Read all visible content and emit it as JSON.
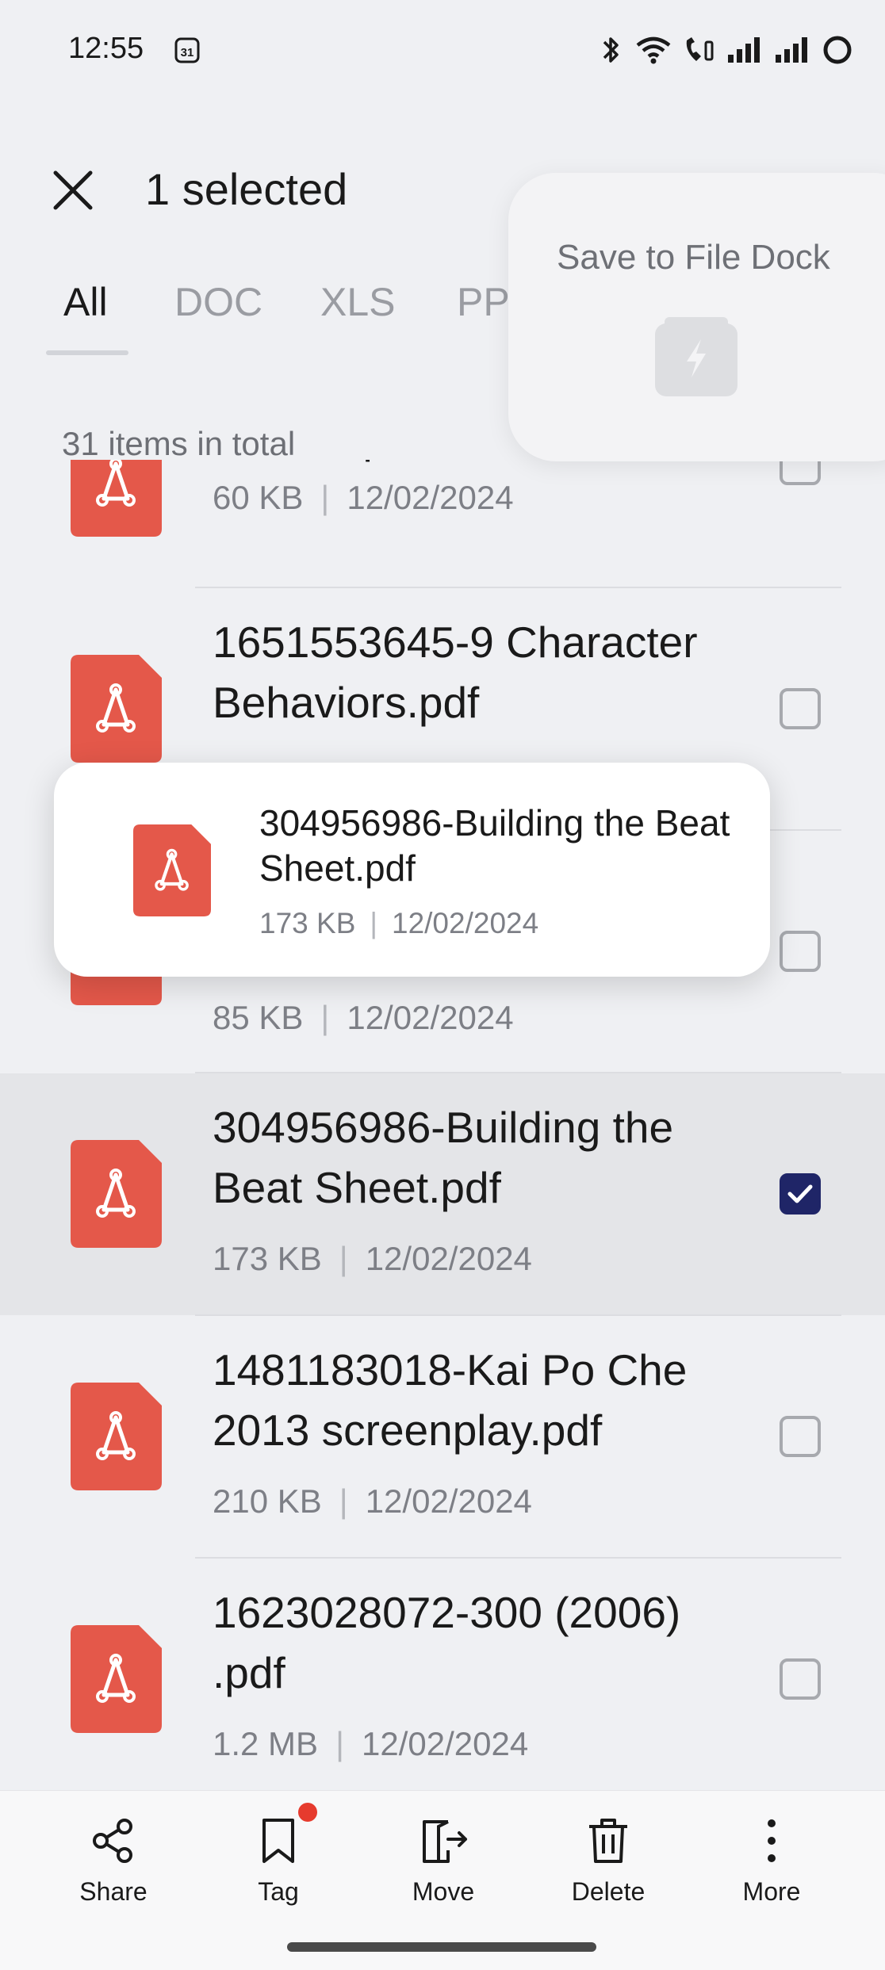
{
  "status_bar": {
    "time": "12:55",
    "calendar_day": "31"
  },
  "header": {
    "title": "1 selected"
  },
  "tabs": [
    {
      "label": "All",
      "active": true
    },
    {
      "label": "DOC",
      "active": false
    },
    {
      "label": "XLS",
      "active": false
    },
    {
      "label": "PP",
      "active": false
    }
  ],
  "list": {
    "total_text": "31 items in total",
    "items": [
      {
        "name": "xercise.pdf",
        "size": "60 KB",
        "date": "12/02/2024",
        "checked": false
      },
      {
        "name": "1651553645-9 Character Behaviors.pdf",
        "size": "",
        "date": "",
        "checked": false
      },
      {
        "name": "",
        "size": "85 KB",
        "date": "12/02/2024",
        "checked": false
      },
      {
        "name": "304956986-Building the Beat Sheet.pdf",
        "size": "173 KB",
        "date": "12/02/2024",
        "checked": true
      },
      {
        "name": "1481183018-Kai Po Che 2013 screenplay.pdf",
        "size": "210 KB",
        "date": "12/02/2024",
        "checked": false
      },
      {
        "name": "1623028072-300 (2006) .pdf",
        "size": "1.2 MB",
        "date": "12/02/2024",
        "checked": false
      }
    ]
  },
  "file_dock": {
    "label": "Save to File Dock"
  },
  "drag_card": {
    "name": "304956986-Building the Beat Sheet.pdf",
    "size": "173 KB",
    "date": "12/02/2024"
  },
  "bottom_bar": {
    "share": "Share",
    "tag": "Tag",
    "move": "Move",
    "delete": "Delete",
    "more": "More"
  },
  "colors": {
    "pdf_red": "#e4584a",
    "checkbox_checked": "#1f2567",
    "badge_red": "#e63b2e"
  }
}
